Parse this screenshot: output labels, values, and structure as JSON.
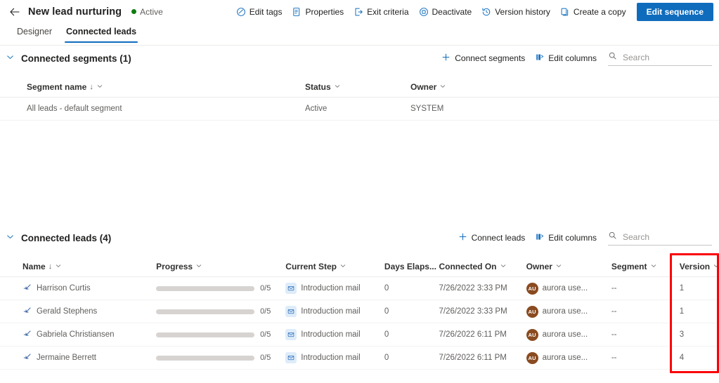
{
  "header": {
    "back_icon": "arrow-left-icon",
    "title": "New lead nurturing",
    "status": "Active",
    "status_color": "#107c10",
    "accent_color": "#0f6cbd",
    "commands": [
      {
        "label": "Edit tags",
        "icon": "tag-icon"
      },
      {
        "label": "Properties",
        "icon": "document-properties-icon"
      },
      {
        "label": "Exit criteria",
        "icon": "exit-icon"
      },
      {
        "label": "Deactivate",
        "icon": "stop-circle-icon"
      },
      {
        "label": "Version history",
        "icon": "history-icon"
      },
      {
        "label": "Create a copy",
        "icon": "copy-icon"
      }
    ],
    "primary_button": "Edit sequence"
  },
  "tabs": [
    {
      "label": "Designer",
      "active": false
    },
    {
      "label": "Connected leads",
      "active": true
    }
  ],
  "segments_section": {
    "title": "Connected segments (1)",
    "collapse_icon": "chevron-down-icon",
    "tools": [
      {
        "label": "Connect segments",
        "icon": "plus-icon"
      },
      {
        "label": "Edit columns",
        "icon": "columns-icon"
      }
    ],
    "search_placeholder": "Search",
    "search_value": "",
    "columns": [
      {
        "label": "Segment name",
        "sorted": true
      },
      {
        "label": "Status",
        "sorted": false
      },
      {
        "label": "Owner",
        "sorted": false
      }
    ],
    "rows": [
      {
        "name": "All leads - default segment",
        "status": "Active",
        "owner": "SYSTEM"
      }
    ]
  },
  "leads_section": {
    "title": "Connected leads (4)",
    "collapse_icon": "chevron-down-icon",
    "tools": [
      {
        "label": "Connect leads",
        "icon": "plus-icon"
      },
      {
        "label": "Edit columns",
        "icon": "columns-icon"
      }
    ],
    "search_placeholder": "Search",
    "search_value": "",
    "columns": [
      {
        "label": "Name",
        "sorted": true
      },
      {
        "label": "Progress",
        "sorted": false
      },
      {
        "label": "Current Step",
        "sorted": false
      },
      {
        "label": "Days Elaps...",
        "sorted": false
      },
      {
        "label": "Connected On",
        "sorted": false
      },
      {
        "label": "Owner",
        "sorted": false
      },
      {
        "label": "Segment",
        "sorted": false
      },
      {
        "label": "Version",
        "sorted": false
      }
    ],
    "rows": [
      {
        "name": "Harrison Curtis",
        "progress_label": "0/5",
        "progress_percent": 0,
        "step": "Introduction mail",
        "days_elapsed": "0",
        "connected_on": "7/26/2022 3:33 PM",
        "owner": "aurora use...",
        "owner_initials": "AU",
        "segment": "--",
        "version": "1"
      },
      {
        "name": "Gerald Stephens",
        "progress_label": "0/5",
        "progress_percent": 0,
        "step": "Introduction mail",
        "days_elapsed": "0",
        "connected_on": "7/26/2022 3:33 PM",
        "owner": "aurora use...",
        "owner_initials": "AU",
        "segment": "--",
        "version": "1"
      },
      {
        "name": "Gabriela Christiansen",
        "progress_label": "0/5",
        "progress_percent": 0,
        "step": "Introduction mail",
        "days_elapsed": "0",
        "connected_on": "7/26/2022 6:11 PM",
        "owner": "aurora use...",
        "owner_initials": "AU",
        "segment": "--",
        "version": "3"
      },
      {
        "name": "Jermaine Berrett",
        "progress_label": "0/5",
        "progress_percent": 0,
        "step": "Introduction mail",
        "days_elapsed": "0",
        "connected_on": "7/26/2022 6:11 PM",
        "owner": "aurora use...",
        "owner_initials": "AU",
        "segment": "--",
        "version": "4"
      }
    ]
  },
  "annotation": {
    "type": "highlight-rectangle",
    "target": "Version column",
    "color": "#fb0007"
  }
}
